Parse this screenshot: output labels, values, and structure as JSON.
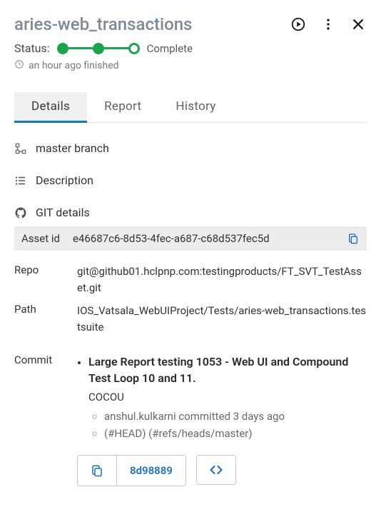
{
  "header": {
    "title": "aries-web_transactions"
  },
  "status": {
    "label": "Status:",
    "text": "Complete",
    "timestamp": "an hour ago finished"
  },
  "tabs": [
    {
      "label": "Details",
      "active": true
    },
    {
      "label": "Report",
      "active": false
    },
    {
      "label": "History",
      "active": false
    }
  ],
  "branch": {
    "label": "master branch"
  },
  "description": {
    "label": "Description"
  },
  "git": {
    "label": "GIT details",
    "asset_id_label": "Asset id",
    "asset_id": "e46687c6-8d53-4fec-a687-c68d537fec5d",
    "repo_label": "Repo",
    "repo": "git@github01.hclpnp.com:testingproducts/FT_SVT_TestAsset.git",
    "path_label": "Path",
    "path": "IOS_Vatsala_WebUIProject/Tests/aries-web_transactions.testsuite"
  },
  "commit": {
    "label": "Commit",
    "title": "Large Report testing 1053 - Web UI and Compound Test Loop 10 and 11.",
    "subtitle": "COCOU",
    "author_line": "anshul.kulkarni committed 3 days ago",
    "refs_line": "(#HEAD) (#refs/heads/master)",
    "short_hash": "8d98889"
  }
}
